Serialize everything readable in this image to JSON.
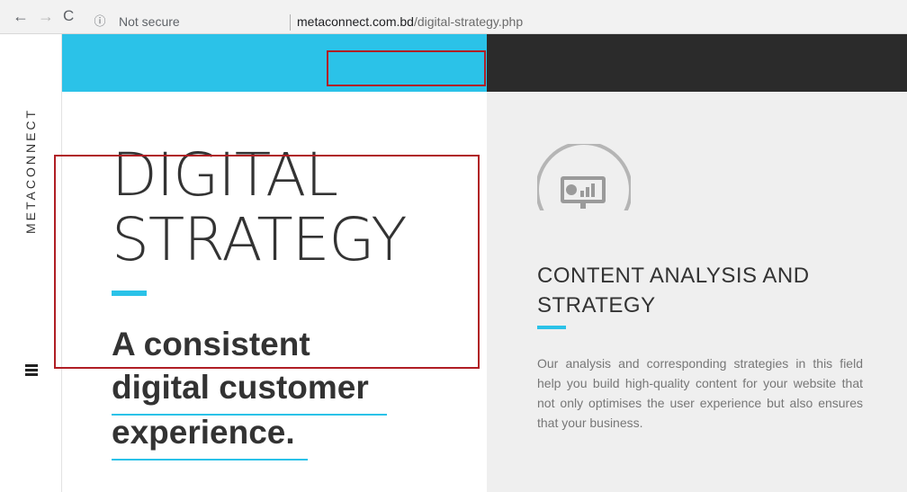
{
  "browser": {
    "back": "←",
    "forward": "→",
    "reload": "C",
    "info": "ⓘ",
    "security_label": "Not secure",
    "url_host": "metaconnect.com.bd",
    "url_path": "/digital-strategy.php"
  },
  "sidebar": {
    "brand": "METACONNECT"
  },
  "hero": {
    "title_line1": "DIGITAL",
    "title_line2": "STRATEGY",
    "tagline_line1": "A consistent",
    "tagline_line2": "digital customer",
    "tagline_line3": "experience."
  },
  "feature": {
    "icon": "presentation-chart-icon",
    "title_line1": "CONTENT ANALYSIS AND",
    "title_line2": "STRATEGY",
    "description": "Our analysis and corresponding strategies in this field help you build high-quality content for your website that not only optimises the user experience but also ensures that your business."
  },
  "colors": {
    "accent": "#2bc2e8",
    "dark": "#2b2b2b",
    "highlight": "#b01e24",
    "panel": "#efefef"
  }
}
